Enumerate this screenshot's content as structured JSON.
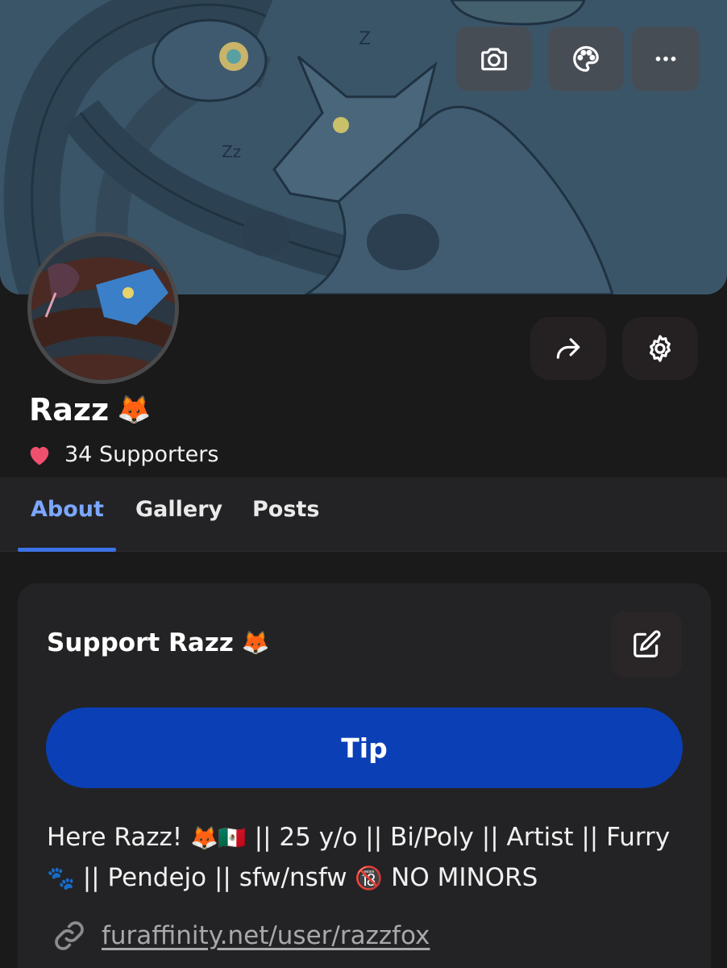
{
  "banner": {
    "buttons": [
      {
        "name": "camera",
        "icon": "camera-icon"
      },
      {
        "name": "palette",
        "icon": "palette-icon"
      },
      {
        "name": "more",
        "icon": "more-dots-icon"
      }
    ]
  },
  "profile": {
    "name": "Razz",
    "name_emoji": "🦊",
    "supporters_label": "34 Supporters",
    "actions": [
      {
        "name": "share",
        "icon": "share-arrow-icon"
      },
      {
        "name": "settings",
        "icon": "gear-icon"
      }
    ]
  },
  "tabs": [
    {
      "label": "About",
      "active": true
    },
    {
      "label": "Gallery",
      "active": false
    },
    {
      "label": "Posts",
      "active": false
    }
  ],
  "support_card": {
    "title": "Support Razz",
    "title_emoji": "🦊",
    "edit_icon": "edit-pencil-icon",
    "tip_label": "Tip",
    "bio_part1": "Here Razz!",
    "bio_emoji1": "🦊🇲🇽",
    "bio_part2": "|| 25 y/o || Bi/Poly || Artist || Furry",
    "bio_emoji2": "🐾",
    "bio_part3": "|| Pendejo || sfw/nsfw",
    "bio_emoji3": "🔞",
    "bio_part4": "NO MINORS",
    "link_icon": "link-icon",
    "link_text": "furaffinity.net/user/razzfox"
  },
  "colors": {
    "background": "#1a1a1b",
    "tab_active": "#7ba7ff",
    "tab_indicator": "#3c72e6",
    "tip_button": "#0b3fb6",
    "heart": "#f0506e",
    "banner_tint": "#3b5568"
  }
}
